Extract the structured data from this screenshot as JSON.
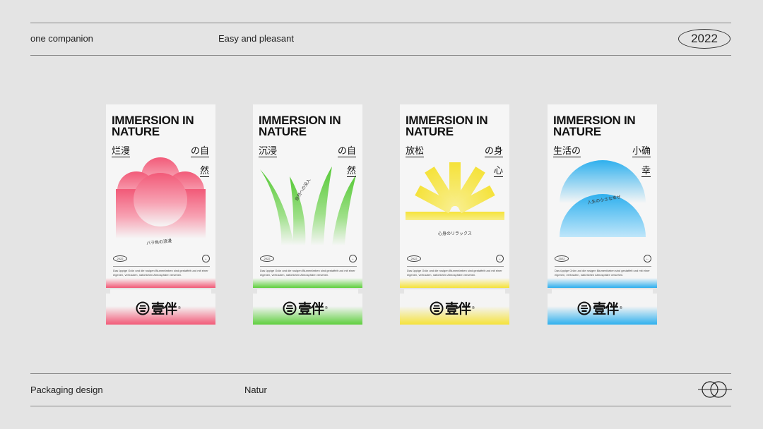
{
  "header": {
    "left": "one companion",
    "center": "Easy and pleasant",
    "year": "2022"
  },
  "footer": {
    "left": "Packaging design",
    "center": "Natur"
  },
  "packs": [
    {
      "title_line1": "IMMERSION IN",
      "title_line2": "NATURE",
      "jp_left": "烂漫",
      "jp_right1": "の自",
      "jp_right2": "然",
      "caption": "バラ色の浪漫",
      "mini_year": "2022",
      "description": "Das üppige Grün und die rosigen Blumenfarben sind gestaffelt und mit einer eigenen, vertrauten, natürlichen Atmosphäre versehen.",
      "logo_text": "壹伴",
      "accent": "#f25a78",
      "art": "flower"
    },
    {
      "title_line1": "IMMERSION IN",
      "title_line2": "NATURE",
      "jp_left": "沉浸",
      "jp_right1": "の自",
      "jp_right2": "然",
      "caption": "自然への没入",
      "mini_year": "2022",
      "description": "Das üppige Grün und die rosigen Blumenfarben sind gestaffelt und mit einer eigenen, vertrauten, natürlichen Atmosphäre versehen.",
      "logo_text": "壹伴",
      "accent": "#5fcf3e",
      "art": "grass"
    },
    {
      "title_line1": "IMMERSION IN",
      "title_line2": "NATURE",
      "jp_left": "放松",
      "jp_right1": "の身",
      "jp_right2": "心",
      "caption": "心身のリラックス",
      "mini_year": "2022",
      "description": "Das üppige Grün und die rosigen Blumenfarben sind gestaffelt und mit einer eigenen, vertrauten, natürlichen Atmosphäre versehen.",
      "logo_text": "壹伴",
      "accent": "#f5e23a",
      "art": "sun"
    },
    {
      "title_line1": "IMMERSION IN",
      "title_line2": "NATURE",
      "jp_left": "生活の",
      "jp_right1": "小确",
      "jp_right2": "幸",
      "caption": "人生の小さな幸せ",
      "mini_year": "2022",
      "description": "Das üppige Grün und die rosigen Blumenfarben sind gestaffelt und mit einer eigenen, vertrauten, natürlichen Atmosphäre versehen.",
      "logo_text": "壹伴",
      "accent": "#2fb0ee",
      "art": "domes"
    }
  ]
}
